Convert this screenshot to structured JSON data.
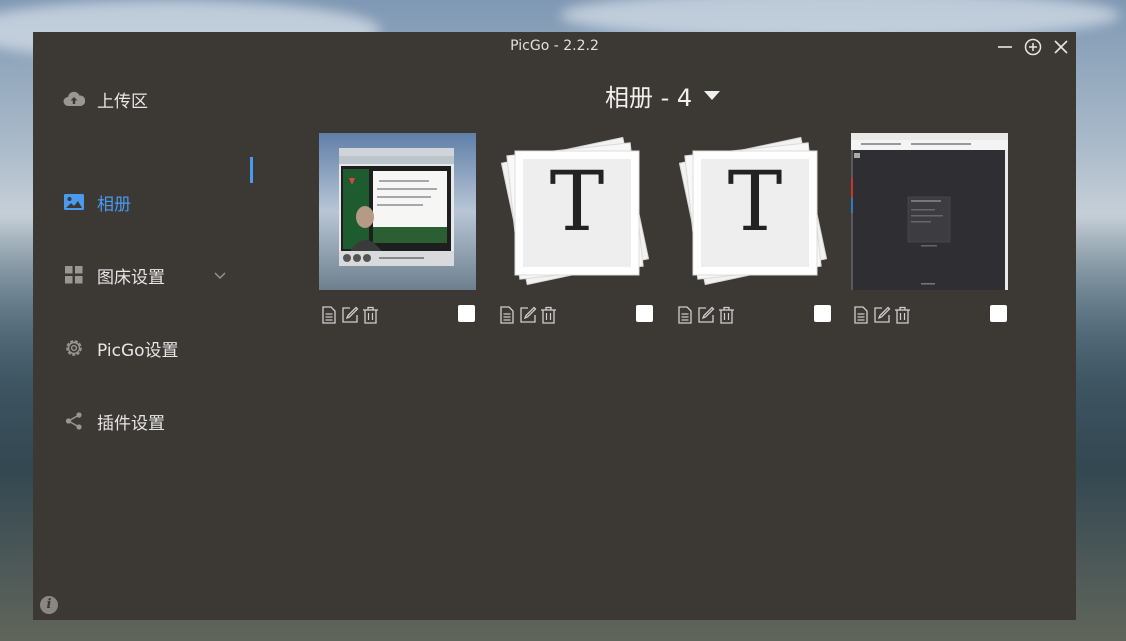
{
  "window": {
    "title": "PicGo - 2.2.2"
  },
  "sidebar": {
    "items": [
      {
        "label": "上传区",
        "icon": "cloud-upload-icon"
      },
      {
        "label": "相册",
        "icon": "image-icon",
        "active": true
      },
      {
        "label": "图床设置",
        "icon": "grid-icon",
        "expandable": true
      },
      {
        "label": "PicGo设置",
        "icon": "gear-icon"
      },
      {
        "label": "插件设置",
        "icon": "share-icon"
      }
    ]
  },
  "gallery": {
    "title": "相册 - 4",
    "images": [
      {
        "kind": "video-screenshot",
        "checked": false
      },
      {
        "kind": "typora-logo",
        "letter": "T",
        "checked": false
      },
      {
        "kind": "typora-logo",
        "letter": "T",
        "checked": false
      },
      {
        "kind": "dark-app-screenshot",
        "checked": false
      }
    ],
    "actions": [
      "copy-link-icon",
      "edit-icon",
      "delete-icon"
    ]
  },
  "colors": {
    "window_bg": "#3c3834",
    "accent": "#4a9af0"
  }
}
